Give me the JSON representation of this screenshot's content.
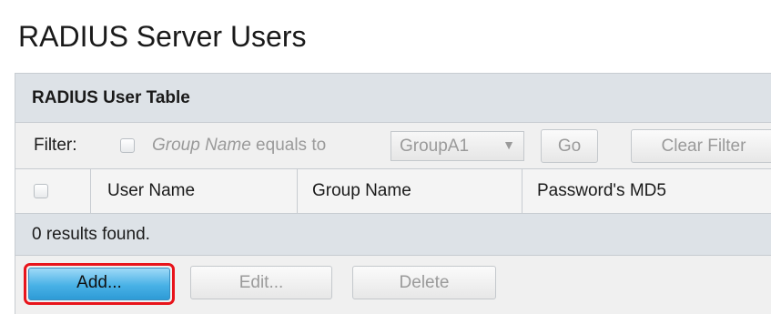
{
  "page": {
    "title": "RADIUS Server Users"
  },
  "panel": {
    "title": "RADIUS User Table"
  },
  "filter": {
    "label": "Filter:",
    "field_name": "Group Name",
    "operator": " equals to",
    "selected_value": "GroupA1",
    "dropdown_arrow": "▼",
    "go_label": "Go",
    "clear_label": "Clear Filter"
  },
  "table": {
    "columns": [
      "User Name",
      "Group Name",
      "Password's MD5"
    ],
    "rows": [],
    "empty_message": "0 results found."
  },
  "actions": {
    "add_label": "Add...",
    "edit_label": "Edit...",
    "delete_label": "Delete",
    "highlight_color": "#e8141b",
    "add_color": "#48b1e6"
  }
}
